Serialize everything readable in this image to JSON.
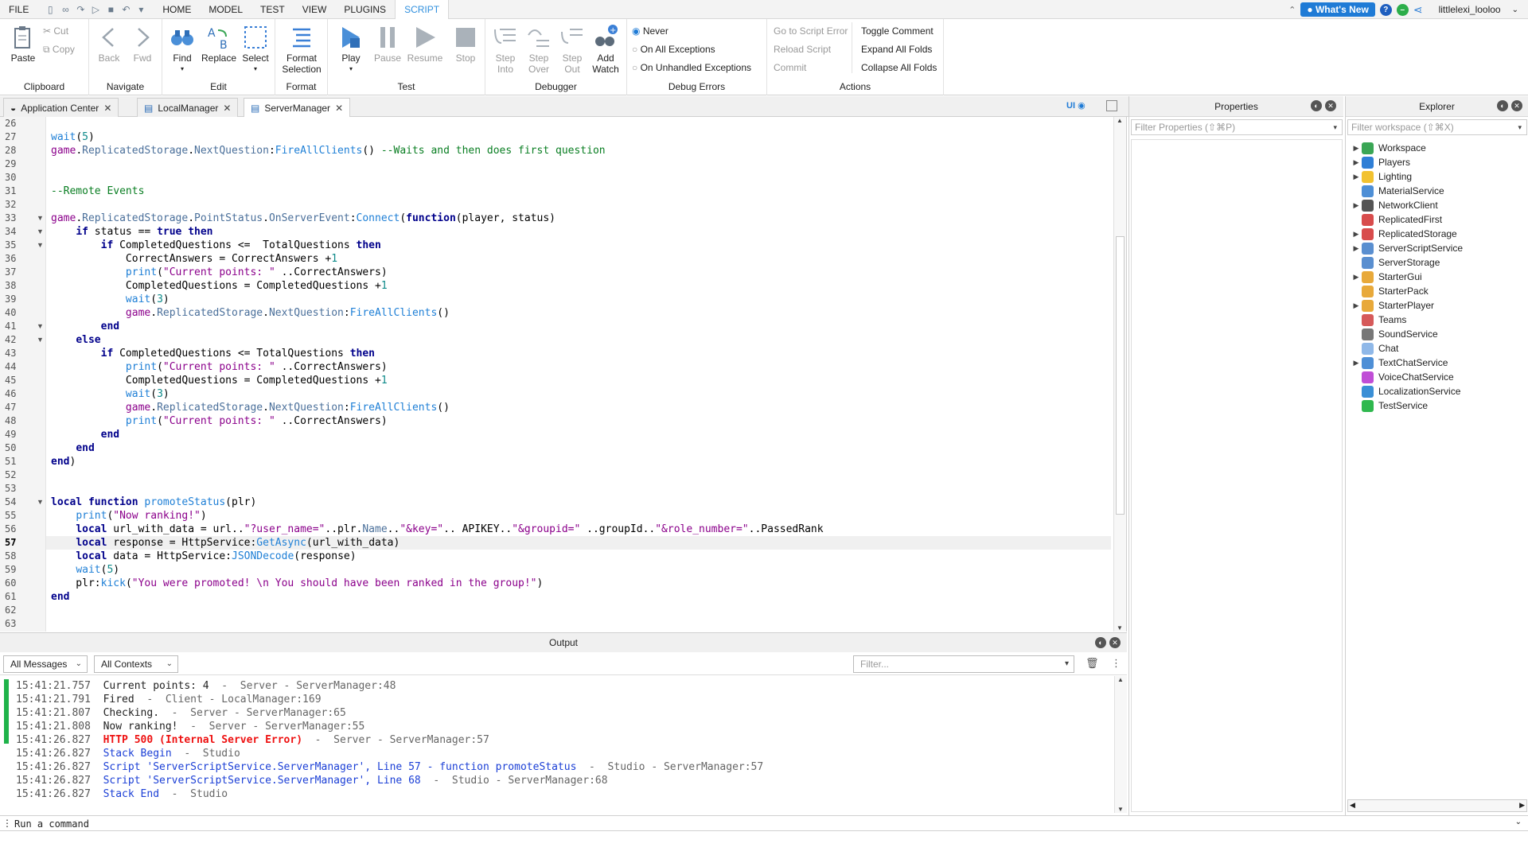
{
  "menubar": {
    "items": [
      "FILE",
      "HOME",
      "MODEL",
      "TEST",
      "VIEW",
      "PLUGINS",
      "SCRIPT"
    ],
    "whats_new": "What's New",
    "username": "littlelexi_looloo"
  },
  "ribbon": {
    "clipboard": {
      "paste": "Paste",
      "cut": "Cut",
      "copy": "Copy",
      "label": "Clipboard"
    },
    "navigate": {
      "back": "Back",
      "fwd": "Fwd",
      "label": "Navigate"
    },
    "edit": {
      "find": "Find",
      "replace": "Replace",
      "select": "Select",
      "label": "Edit"
    },
    "format": {
      "format_selection_1": "Format",
      "format_selection_2": "Selection",
      "label": "Format"
    },
    "test": {
      "play": "Play",
      "pause": "Pause",
      "resume": "Resume",
      "stop": "Stop",
      "label": "Test"
    },
    "debugger": {
      "step_into_1": "Step",
      "step_into_2": "Into",
      "step_over_1": "Step",
      "step_over_2": "Over",
      "step_out_1": "Step",
      "step_out_2": "Out",
      "add_watch_1": "Add",
      "add_watch_2": "Watch",
      "label": "Debugger"
    },
    "debug_errors": {
      "never": "Never",
      "all": "On All Exceptions",
      "unhandled": "On Unhandled Exceptions",
      "label": "Debug Errors",
      "selected": "Never"
    },
    "actions": {
      "go_to_error": "Go to Script Error",
      "reload": "Reload Script",
      "commit": "Commit",
      "toggle_comment": "Toggle Comment",
      "expand_folds": "Expand All Folds",
      "collapse_folds": "Collapse All Folds",
      "label": "Actions"
    }
  },
  "tabs": [
    {
      "label": "Application Center",
      "active": false
    },
    {
      "label": "LocalManager",
      "active": false
    },
    {
      "label": "ServerManager",
      "active": true
    }
  ],
  "editor": {
    "ui_toggle": "UI",
    "current_line": "57",
    "line_numbers": [
      "26",
      "27",
      "28",
      "29",
      "30",
      "31",
      "32",
      "33",
      "34",
      "35",
      "36",
      "37",
      "38",
      "39",
      "40",
      "41",
      "42",
      "43",
      "44",
      "45",
      "46",
      "47",
      "48",
      "49",
      "50",
      "51",
      "52",
      "53",
      "54",
      "55",
      "56",
      "57",
      "58",
      "59",
      "60",
      "61",
      "62",
      "63"
    ]
  },
  "output": {
    "title": "Output",
    "messages_filter": "All Messages",
    "contexts_filter": "All Contexts",
    "filter_placeholder": "Filter...",
    "logs": [
      {
        "time": "15:41:21.757",
        "msg": "Current points: 4",
        "src": "  -  Server - ServerManager:48",
        "type": "normal"
      },
      {
        "time": "15:41:21.791",
        "msg": "Fired",
        "src": "  -  Client - LocalManager:169",
        "type": "normal"
      },
      {
        "time": "15:41:21.807",
        "msg": "Checking.",
        "src": "  -  Server - ServerManager:65",
        "type": "normal"
      },
      {
        "time": "15:41:21.808",
        "msg": "Now ranking!",
        "src": "  -  Server - ServerManager:55",
        "type": "normal"
      },
      {
        "time": "15:41:26.827",
        "msg": "HTTP 500 (Internal Server Error)",
        "src": "  -  Server - ServerManager:57",
        "type": "error"
      },
      {
        "time": "15:41:26.827",
        "msg": "Stack Begin",
        "src": "  -  Studio",
        "type": "info"
      },
      {
        "time": "15:41:26.827",
        "msg": "Script 'ServerScriptService.ServerManager', Line 57 - function promoteStatus",
        "src": "  -  Studio - ServerManager:57",
        "type": "info"
      },
      {
        "time": "15:41:26.827",
        "msg": "Script 'ServerScriptService.ServerManager', Line 68",
        "src": "  -  Studio - ServerManager:68",
        "type": "info"
      },
      {
        "time": "15:41:26.827",
        "msg": "Stack End",
        "src": "  -  Studio",
        "type": "info"
      }
    ]
  },
  "command_bar": {
    "placeholder": "Run a command"
  },
  "properties": {
    "title": "Properties",
    "filter": "Filter Properties (⇧⌘P)"
  },
  "explorer": {
    "title": "Explorer",
    "filter": "Filter workspace (⇧⌘X)",
    "items": [
      {
        "label": "Workspace",
        "expandable": true,
        "color": "#3aa655"
      },
      {
        "label": "Players",
        "expandable": true,
        "color": "#2f7fd6"
      },
      {
        "label": "Lighting",
        "expandable": true,
        "color": "#f2c230"
      },
      {
        "label": "MaterialService",
        "expandable": false,
        "color": "#4e8fd6"
      },
      {
        "label": "NetworkClient",
        "expandable": true,
        "color": "#555555"
      },
      {
        "label": "ReplicatedFirst",
        "expandable": false,
        "color": "#d84c4c"
      },
      {
        "label": "ReplicatedStorage",
        "expandable": true,
        "color": "#d84c4c"
      },
      {
        "label": "ServerScriptService",
        "expandable": true,
        "color": "#5a8fd0"
      },
      {
        "label": "ServerStorage",
        "expandable": false,
        "color": "#5a8fd0"
      },
      {
        "label": "StarterGui",
        "expandable": true,
        "color": "#e8a93a"
      },
      {
        "label": "StarterPack",
        "expandable": false,
        "color": "#e8a93a"
      },
      {
        "label": "StarterPlayer",
        "expandable": true,
        "color": "#e8a93a"
      },
      {
        "label": "Teams",
        "expandable": false,
        "color": "#d65a5a"
      },
      {
        "label": "SoundService",
        "expandable": false,
        "color": "#777777"
      },
      {
        "label": "Chat",
        "expandable": false,
        "color": "#8fb8e8"
      },
      {
        "label": "TextChatService",
        "expandable": true,
        "color": "#4e8fd6"
      },
      {
        "label": "VoiceChatService",
        "expandable": false,
        "color": "#c04ed6"
      },
      {
        "label": "LocalizationService",
        "expandable": false,
        "color": "#3a8fd6"
      },
      {
        "label": "TestService",
        "expandable": false,
        "color": "#2fb84e"
      }
    ]
  }
}
